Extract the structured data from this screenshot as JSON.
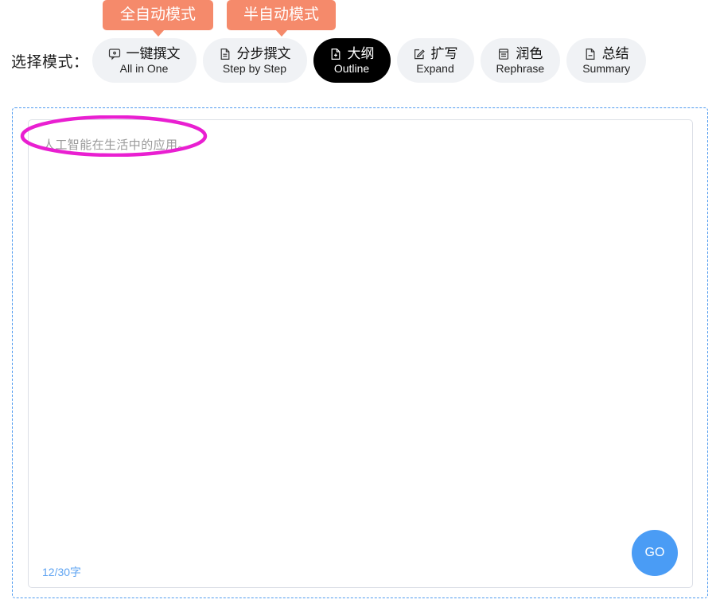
{
  "badges": [
    {
      "id": "all-in-one",
      "label": "全自动模式"
    },
    {
      "id": "step-by-step",
      "label": "半自动模式"
    }
  ],
  "mode_selector": {
    "label": "选择模式：",
    "modes": [
      {
        "id": "all-in-one",
        "cn": "一键撰文",
        "en": "All in One",
        "icon": "comment-dot-icon",
        "active": false
      },
      {
        "id": "step-by-step",
        "cn": "分步撰文",
        "en": "Step by Step",
        "icon": "document-icon",
        "active": false
      },
      {
        "id": "outline",
        "cn": "大纲",
        "en": "Outline",
        "icon": "file-plus-icon",
        "active": true
      },
      {
        "id": "expand",
        "cn": "扩写",
        "en": "Expand",
        "icon": "edit-square-icon",
        "active": false
      },
      {
        "id": "rephrase",
        "cn": "润色",
        "en": "Rephrase",
        "icon": "list-lines-icon",
        "active": false
      },
      {
        "id": "summary",
        "cn": "总结",
        "en": "Summary",
        "icon": "file-icon",
        "active": false
      }
    ]
  },
  "editor": {
    "prompt_value": "人工智能在生活中的应用。",
    "placeholder": "人工智能在生活中的应用。",
    "char_counter": "12/30字",
    "go_label": "GO"
  },
  "annotation": {
    "shape": "ellipse",
    "color": "#e91fd1"
  },
  "colors": {
    "badge_orange": "#f58a6b",
    "active_button": "#000000",
    "button_bg": "#f0f2f5",
    "go_blue": "#4a9cf5",
    "counter_blue": "#5fa4f2",
    "dashed_border": "#4f9bf0",
    "annotation_pink": "#e91fd1"
  }
}
